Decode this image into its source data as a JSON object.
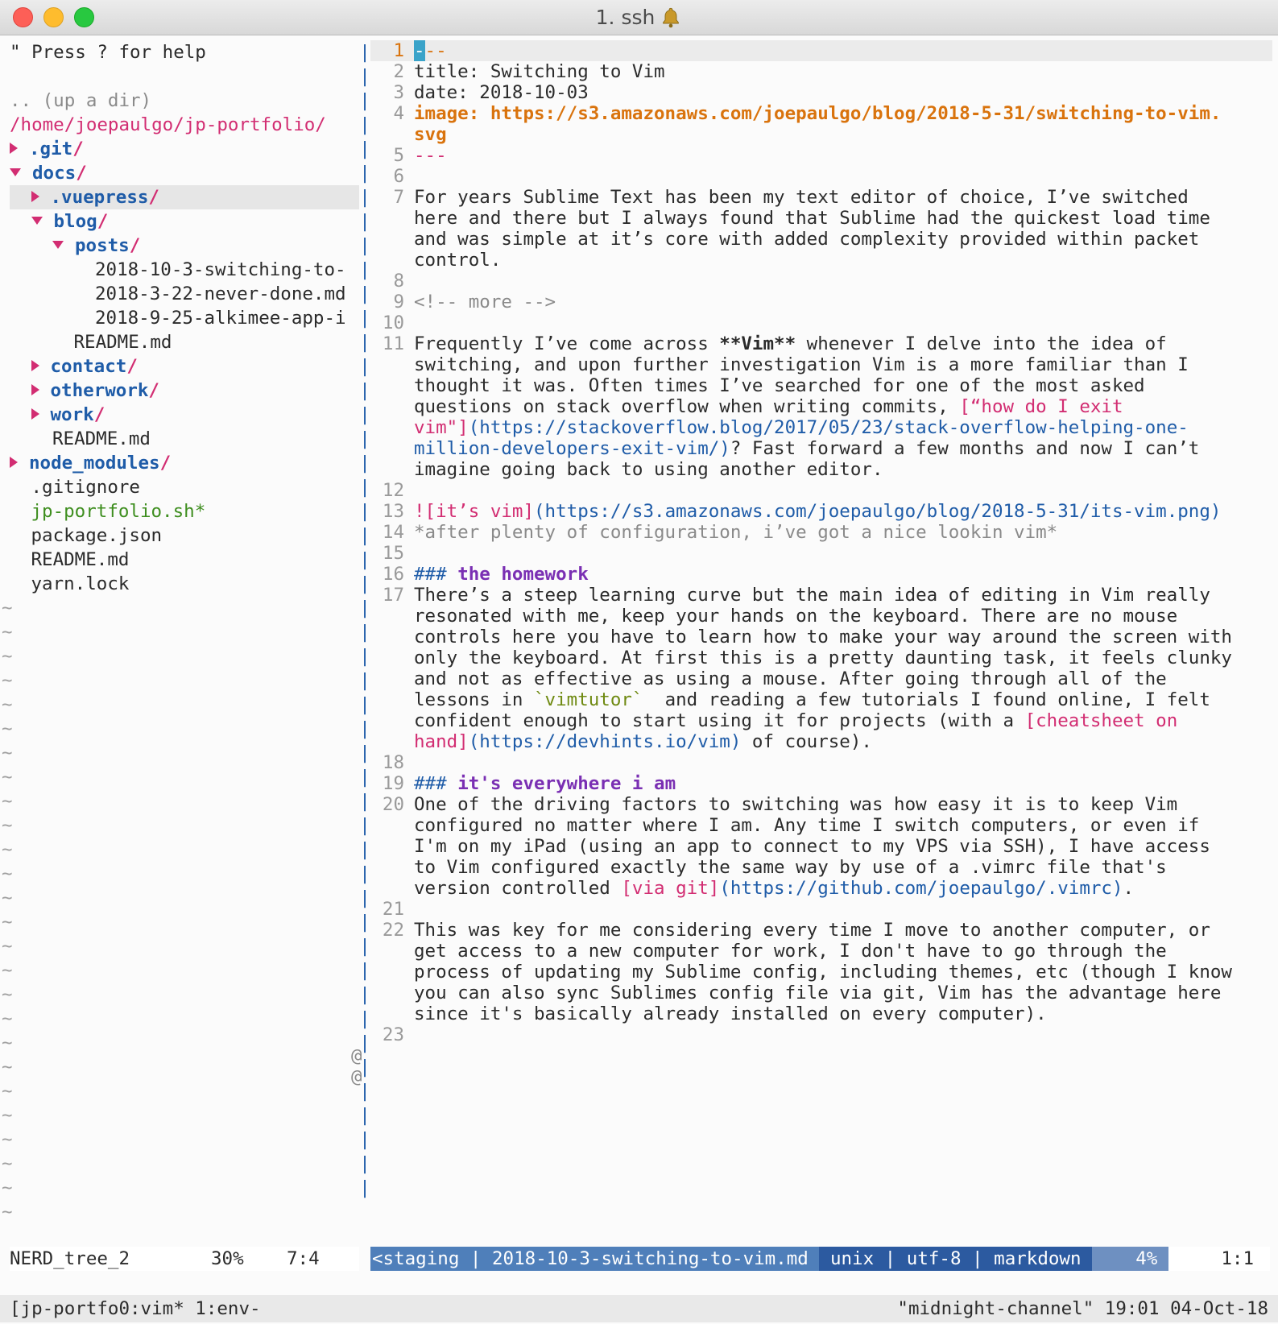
{
  "window": {
    "title": "1. ssh",
    "bell_icon": "bell-icon"
  },
  "tree": {
    "help": "\" Press ? for help",
    "up": ".. (up a dir)",
    "root": "/home/joepaulgo/jp-portfolio/",
    "items": [
      {
        "indent": 0,
        "toggle": "closed",
        "name": ".git",
        "type": "dir"
      },
      {
        "indent": 0,
        "toggle": "open",
        "name": "docs",
        "type": "dir"
      },
      {
        "indent": 1,
        "toggle": "closed",
        "name": ".vuepress",
        "type": "dir",
        "highlight": true
      },
      {
        "indent": 1,
        "toggle": "open",
        "name": "blog",
        "type": "dir"
      },
      {
        "indent": 2,
        "toggle": "open",
        "name": "posts",
        "type": "dir"
      },
      {
        "indent": 3,
        "name": "2018-10-3-switching-to-",
        "type": "file"
      },
      {
        "indent": 3,
        "name": "2018-3-22-never-done.md",
        "type": "file"
      },
      {
        "indent": 3,
        "name": "2018-9-25-alkimee-app-i",
        "type": "file"
      },
      {
        "indent": 2,
        "name": "README.md",
        "type": "file"
      },
      {
        "indent": 1,
        "toggle": "closed",
        "name": "contact",
        "type": "dir"
      },
      {
        "indent": 1,
        "toggle": "closed",
        "name": "otherwork",
        "type": "dir"
      },
      {
        "indent": 1,
        "toggle": "closed",
        "name": "work",
        "type": "dir"
      },
      {
        "indent": 1,
        "name": "README.md",
        "type": "file"
      },
      {
        "indent": 0,
        "toggle": "closed",
        "name": "node_modules",
        "type": "dir"
      },
      {
        "indent": 0,
        "name": ".gitignore",
        "type": "file"
      },
      {
        "indent": 0,
        "name": "jp-portfolio.sh*",
        "type": "exec"
      },
      {
        "indent": 0,
        "name": "package.json",
        "type": "file"
      },
      {
        "indent": 0,
        "name": "README.md",
        "type": "file"
      },
      {
        "indent": 0,
        "name": "yarn.lock",
        "type": "file"
      }
    ],
    "tilde": "~"
  },
  "editor": {
    "cursor_char": "-",
    "lines": {
      "l1": "--",
      "l2": "title: Switching to Vim",
      "l3": "date: 2018-10-03",
      "l4a": "image: https://s3.amazonaws.com/joepaulgo/blog/2018-5-31/switching-to-vim.",
      "l4b": "svg",
      "l5": "---",
      "l7a": "For years Sublime Text has been my text editor of choice, I’ve switched",
      "l7b": "here and there but I always found that Sublime had the quickest load time",
      "l7c": "and was simple at it’s core with added complexity provided within packet",
      "l7d": "control.",
      "l9": "<!-- more -->",
      "l11a1": "Frequently I’ve come across ",
      "l11a2": "**Vim**",
      "l11a3": " whenever I delve into the idea of",
      "l11b": "switching, and upon further investigation Vim is a more familiar than I",
      "l11c": "thought it was. Often times I’ve searched for one of the most asked",
      "l11d1": "questions on stack overflow when writing commits, ",
      "l11d2": "[“how do I exit",
      "l11e1": "vim\"]",
      "l11e2": "(https://stackoverflow.blog/2017/05/23/stack-overflow-helping-one-",
      "l11f1": "million-developers-exit-vim/)",
      "l11f2": "? Fast forward a few months and now I can’t",
      "l11g": "imagine going back to using another editor.",
      "l13a": "!",
      "l13b": "[it’s vim]",
      "l13c": "(https://s3.amazonaws.com/joepaulgo/blog/2018-5-31/its-vim.png)",
      "l14": "*after plenty of configuration, i’ve got a nice lookin vim*",
      "l16a": "### ",
      "l16b": "the homework",
      "l17a": "There’s a steep learning curve but the main idea of editing in Vim really",
      "l17b": "resonated with me, keep your hands on the keyboard. There are no mouse",
      "l17c": "controls here you have to learn how to make your way around the screen with",
      "l17d": "only the keyboard. At first this is a pretty daunting task, it feels clunky",
      "l17e": "and not as effective as using a mouse. After going through all of the",
      "l17f1": "lessons in ",
      "l17f2": "`vimtutor`",
      "l17f3": "  and reading a few tutorials I found online, I felt",
      "l17g1": "confident enough to start using it for projects (with a ",
      "l17g2": "[cheatsheet on",
      "l17h1": "hand]",
      "l17h2": "(https://devhints.io/vim)",
      "l17h3": " of course).",
      "l19a": "### ",
      "l19b": "it's everywhere i am",
      "l20a": "One of the driving factors to switching was how easy it is to keep Vim",
      "l20b": "configured no matter where I am. Any time I switch computers, or even if",
      "l20c": "I'm on my iPad (using an app to connect to my VPS via SSH), I have access",
      "l20d": "to Vim configured exactly the same way by use of a .vimrc file that's",
      "l20e1": "version controlled ",
      "l20e2": "[via git]",
      "l20e3": "(https://github.com/joepaulgo/.vimrc)",
      "l20e4": ".",
      "l22a": "This was key for me considering every time I move to another computer, or",
      "l22b": "get access to a new computer for work, I don't have to go through the",
      "l22c": "process of updating my Sublime config, including themes, etc (though I know",
      "l22d": "you can also sync Sublimes config file via git, Vim has the advantage here",
      "l22e": "since it's basically already installed on every computer).",
      "at": "@"
    }
  },
  "statusline": {
    "tree_name": "NERD_tree_2",
    "tree_pct": "30%",
    "tree_pos": "7:4",
    "branch": "<staging | 2018-10-3-switching-to-vim.md ",
    "fileinfo": " unix | utf-8 | markdown ",
    "pct": "    4% ",
    "pos": "1:1"
  },
  "tmux": {
    "left": "[jp-portfo0:vim* 1:env-",
    "right": "\"midnight-channel\" 19:01 04-Oct-18"
  }
}
